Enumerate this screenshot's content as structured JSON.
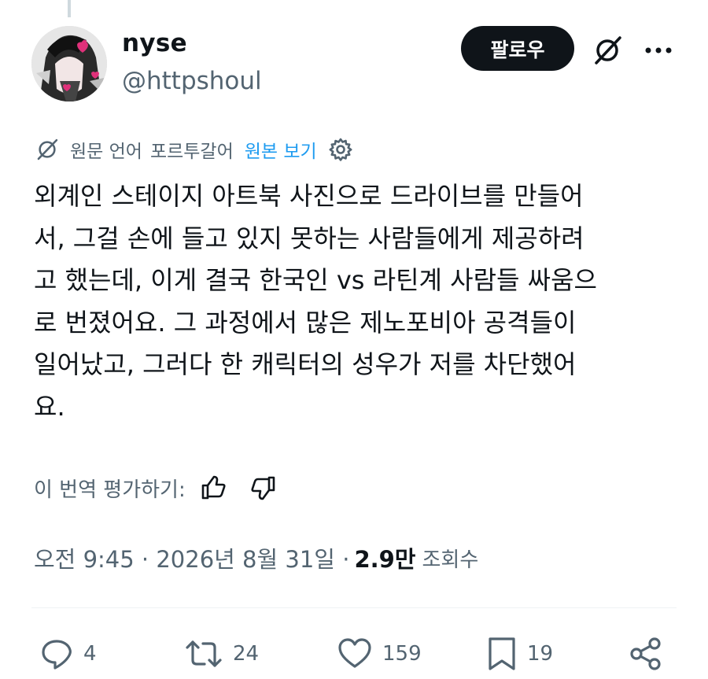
{
  "author": {
    "display_name": "nyse",
    "handle": "@httpshoul"
  },
  "follow_button": {
    "label": "팔로우"
  },
  "translation": {
    "note": "원문 언어",
    "language": "포르투갈어",
    "view_original": "원본 보기"
  },
  "post": {
    "text": "외계인 스테이지 아트북 사진으로 드라이브를 만들어\n서, 그걸 손에 들고 있지 못하는 사람들에게 제공하려\n고 했는데, 이게 결국 한국인 vs 라틴계 사람들 싸움으\n로 번졌어요. 그 과정에서 많은 제노포비아 공격들이\n일어났고, 그러다 한 캐릭터의 성우가 저를 차단했어\n요."
  },
  "rating": {
    "label": "이 번역 평가하기:"
  },
  "meta": {
    "time": "오전 9:45 · 2026년 8월 31일 ·",
    "views": "2.9만",
    "views_label": "조회수"
  },
  "actions": {
    "replies": "4",
    "reposts": "24",
    "likes": "159",
    "bookmarks": "19"
  },
  "colors": {
    "text": "#0f1419",
    "secondary": "#536471",
    "link": "#1d9bf0",
    "accent_pink": "#e0317a"
  },
  "icons": [
    "grok-icon",
    "more-icon",
    "gear-icon",
    "thumbs-up-icon",
    "thumbs-down-icon",
    "reply-icon",
    "repost-icon",
    "like-icon",
    "bookmark-icon",
    "share-icon"
  ]
}
